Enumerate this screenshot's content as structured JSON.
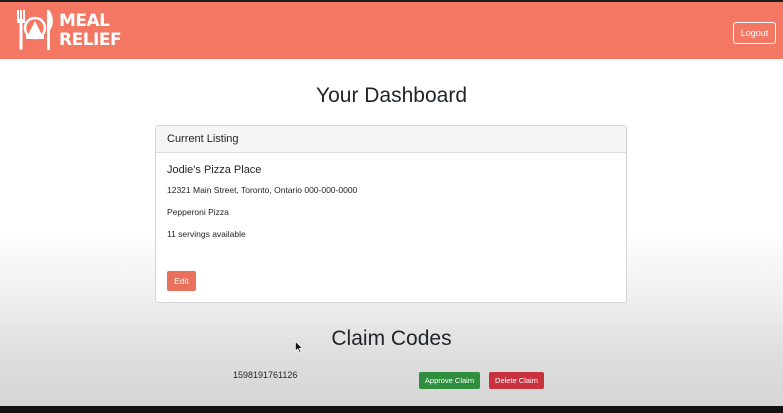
{
  "header": {
    "logo_line1": "MEAL",
    "logo_line2": "RELIEF",
    "logout_label": "Logout",
    "brand_color": "#f37763"
  },
  "main": {
    "title": "Your Dashboard"
  },
  "listing": {
    "header": "Current Listing",
    "restaurant_name": "Jodie's Pizza Place",
    "address": "12321 Main Street, Toronto, Ontario 000-000-0000",
    "food_item": "Pepperoni Pizza",
    "servings": "11 servings available",
    "edit_label": "Edit"
  },
  "claims": {
    "title": "Claim Codes",
    "items": [
      {
        "code": "1598191761126",
        "approve_label": "Approve Claim",
        "delete_label": "Delete Claim"
      }
    ]
  }
}
